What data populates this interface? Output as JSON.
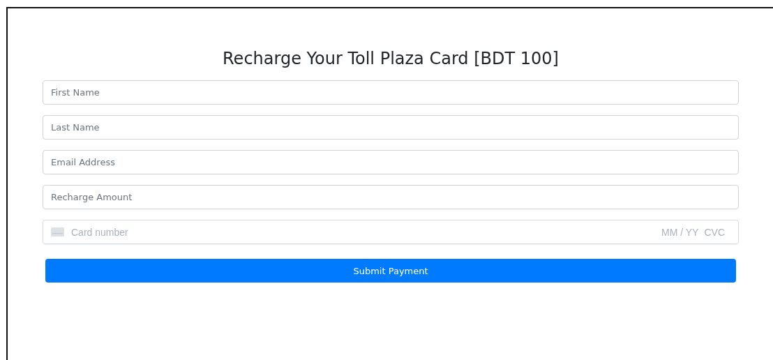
{
  "title": "Recharge Your Toll Plaza Card [BDT 100]",
  "fields": [
    {
      "placeholder": "First Name"
    },
    {
      "placeholder": "Last Name"
    },
    {
      "placeholder": "Email Address"
    },
    {
      "placeholder": "Recharge Amount"
    }
  ],
  "card_field": {
    "placeholder": "Card number",
    "expiry": "MM / YY",
    "cvc": "CVC"
  },
  "submit_button": "Submit Payment"
}
